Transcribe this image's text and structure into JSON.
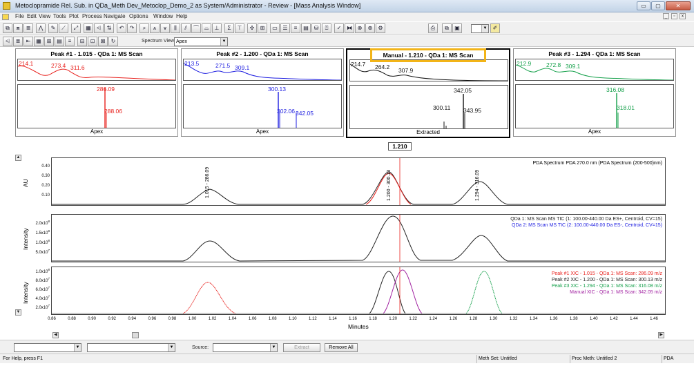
{
  "window": {
    "title": "Metoclopramide Rel. Sub. in QDa_Meth Dev_Metoclop_Demo_2 as System/Administrator - Review - [Mass Analysis Window]",
    "min_label": "▭",
    "max_label": "▢",
    "close_label": "✕"
  },
  "menu": {
    "items": [
      "File",
      "Edit",
      "View",
      "Tools",
      "Plot",
      "Process",
      "Navigate",
      "Options",
      "Window",
      "Help"
    ],
    "mdi": [
      "_",
      "▫",
      "x"
    ]
  },
  "toolbar": {
    "spectrum_view_label": "Spectrum View",
    "spectrum_view_value": "Apex"
  },
  "spectra": [
    {
      "title": "Peak #1 - 1.015 - QDa 1: MS Scan",
      "color": "#e8201c",
      "uv_labels": [
        "214.1",
        "273.4",
        "311.6"
      ],
      "ms_labels": [
        "286.09",
        "288.06"
      ],
      "footer": "Apex"
    },
    {
      "title": "Peak #2 - 1.200 - QDa 1: MS Scan",
      "color": "#1c1ce0",
      "uv_labels": [
        "213.5",
        "271.5",
        "309.1"
      ],
      "ms_labels": [
        "300.13",
        "302.06",
        "342.05"
      ],
      "footer": "Apex"
    },
    {
      "title": "Manual - 1.210 - QDa 1: MS Scan",
      "color": "#111111",
      "uv_labels": [
        "214.7",
        "264.2",
        "307.9"
      ],
      "ms_labels": [
        "342.05",
        "300.11",
        "343.95"
      ],
      "footer": "Extracted"
    },
    {
      "title": "Peak #3 - 1.294 - QDa 1: MS Scan",
      "color": "#14a04a",
      "uv_labels": [
        "212.9",
        "272.8",
        "309.1"
      ],
      "ms_labels": [
        "316.08",
        "318.01"
      ],
      "footer": "Apex"
    }
  ],
  "retention_marker": "1.210",
  "pda_trace": {
    "legend": "PDA Spectrum PDA 270.0 nm (PDA Spectrum (200-500)nm)",
    "y_title": "AU",
    "y_ticks": [
      "0.40",
      "0.30",
      "0.20",
      "0.10"
    ],
    "peak_labels": [
      "1.015 - 286.09",
      "1.200 - 300.13",
      "1.294 - 316.09"
    ]
  },
  "tic_trace": {
    "legend": [
      "QDa 1: MS Scan MS TIC (1: 100.00-440.00 Da ES+, Centroid, CV=15)",
      "QDa 2: MS Scan MS TIC (2: 100.00-440.00 Da ES-, Centroid, CV=15)"
    ],
    "y_title": "Intensity",
    "y_ticks": [
      {
        "mant": "2.0x10",
        "exp": "8"
      },
      {
        "mant": "1.5x10",
        "exp": "8"
      },
      {
        "mant": "1.0x10",
        "exp": "8"
      },
      {
        "mant": "5.0x10",
        "exp": "7"
      }
    ]
  },
  "xic_trace": {
    "legend": [
      "Peak #1 XIC - 1.015 - QDa 1: MS Scan: 286.09 m/z",
      "Peak #2 XIC - 1.200 - QDa 1: MS Scan: 300.13 m/z",
      "Peak #3 XIC - 1.294 - QDa 1: MS Scan: 316.08 m/z",
      "Manual XIC - QDa 1: MS Scan: 342.05 m/z"
    ],
    "y_title": "Intensity",
    "y_ticks": [
      {
        "mant": "1.0x10",
        "exp": "8"
      },
      {
        "mant": "8.0x10",
        "exp": "7"
      },
      {
        "mant": "6.0x10",
        "exp": "7"
      },
      {
        "mant": "4.0x10",
        "exp": "7"
      },
      {
        "mant": "2.0x10",
        "exp": "7"
      }
    ]
  },
  "colors": {
    "peak1": "#e8201c",
    "peak2": "#222222",
    "peak3": "#14a04a",
    "manual": "#a020a0",
    "tic2": "#1c1ce0",
    "highlight": "#f2b418"
  },
  "x_axis": {
    "title": "Minutes",
    "ticks": [
      "0.86",
      "0.88",
      "0.90",
      "0.92",
      "0.94",
      "0.96",
      "0.98",
      "1.00",
      "1.02",
      "1.04",
      "1.06",
      "1.08",
      "1.10",
      "1.12",
      "1.14",
      "1.16",
      "1.18",
      "1.20",
      "1.22",
      "1.24",
      "1.26",
      "1.28",
      "1.30",
      "1.32",
      "1.34",
      "1.36",
      "1.38",
      "1.40",
      "1.42",
      "1.44",
      "1.46"
    ]
  },
  "bottom": {
    "source_label": "Source:",
    "extract_label": "Extract",
    "remove_all_label": "Remove All"
  },
  "status": {
    "help": "For Help, press F1",
    "meth_set": "Meth Set: Untitled",
    "proc_meth": "Proc Meth: Untitled 2",
    "mode": "PDA"
  }
}
